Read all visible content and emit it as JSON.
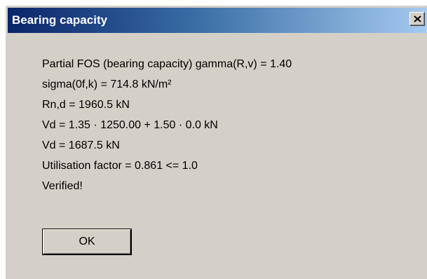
{
  "window": {
    "title": "Bearing capacity"
  },
  "lines": [
    "Partial FOS (bearing capacity) gamma(R,v) = 1.40",
    "sigma(0f,k) = 714.8 kN/m²",
    "Rn,d = 1960.5 kN",
    "Vd = 1.35 · 1250.00 + 1.50 · 0.0 kN",
    "Vd = 1687.5 kN",
    "Utilisation factor = 0.861 <= 1.0",
    "Verified!"
  ],
  "buttons": {
    "ok_label": "OK"
  },
  "icons": {
    "close": "close-icon"
  },
  "colors": {
    "title_bar_start": "#0a246a",
    "title_bar_end": "#a6caf0",
    "dialog_background": "#d4d0c8"
  }
}
